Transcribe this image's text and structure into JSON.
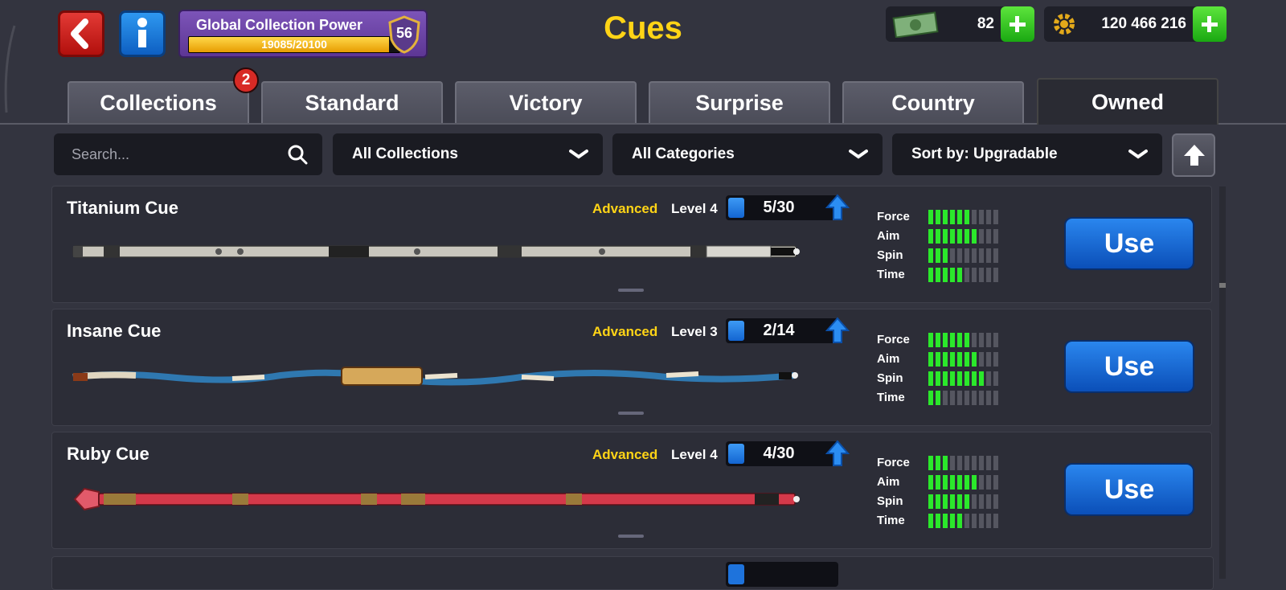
{
  "header": {
    "title": "Cues",
    "global_power_label": "Global Collection Power",
    "global_power_value": "19085/20100",
    "global_power_fraction": 0.9495,
    "level": "56",
    "cash": "82",
    "coins": "120 466 216"
  },
  "tabs": [
    {
      "label": "Collections",
      "badge": "2"
    },
    {
      "label": "Standard"
    },
    {
      "label": "Victory"
    },
    {
      "label": "Surprise"
    },
    {
      "label": "Country"
    },
    {
      "label": "Owned",
      "active": true
    }
  ],
  "filters": {
    "search_placeholder": "Search...",
    "collections": "All Collections",
    "categories": "All Categories",
    "sort": "Sort by: Upgradable"
  },
  "stat_labels": [
    "Force",
    "Aim",
    "Spin",
    "Time"
  ],
  "use_label": "Use",
  "cues": [
    {
      "name": "Titanium Cue",
      "tier": "Advanced",
      "level": "Level 4",
      "progress": "5/30",
      "stats": [
        6,
        7,
        3,
        5
      ]
    },
    {
      "name": "Insane Cue",
      "tier": "Advanced",
      "level": "Level 3",
      "progress": "2/14",
      "stats": [
        6,
        7,
        8,
        2
      ]
    },
    {
      "name": "Ruby Cue",
      "tier": "Advanced",
      "level": "Level 4",
      "progress": "4/30",
      "stats": [
        3,
        7,
        6,
        5
      ]
    }
  ],
  "colors": {
    "accent_yellow": "#ffd416",
    "stat_green": "#2be82b",
    "use_blue": "#1a6fdc"
  }
}
